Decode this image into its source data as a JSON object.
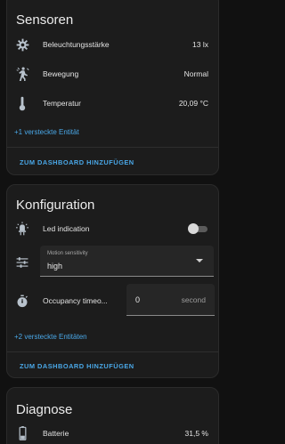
{
  "colors": {
    "background": "#111111",
    "card": "#1c1c1c",
    "icon": "#b8c2cc",
    "accent": "#4aa8e8",
    "battery": "#2e7d32"
  },
  "sensors": {
    "title": "Sensoren",
    "rows": [
      {
        "icon": "brightness-gear-icon",
        "label": "Beleuchtungsstärke",
        "value": "13 lx"
      },
      {
        "icon": "motion-sensor-icon",
        "label": "Bewegung",
        "value": "Normal"
      },
      {
        "icon": "thermometer-icon",
        "label": "Temperatur",
        "value": "20,09 °C"
      }
    ],
    "hidden_link": "+1 versteckte Entität",
    "action": "ZUM DASHBOARD HINZUFÜGEN"
  },
  "config": {
    "title": "Konfiguration",
    "led": {
      "icon": "led-icon",
      "label": "Led indication",
      "state": "off"
    },
    "motion": {
      "icon": "tune-sliders-icon",
      "field_label": "Motion sensitivity",
      "value": "high"
    },
    "occupancy": {
      "icon": "timer-icon",
      "label": "Occupancy timeo...",
      "value": "0",
      "unit": "second"
    },
    "hidden_link": "+2 versteckte Entitäten",
    "action": "ZUM DASHBOARD HINZUFÜGEN"
  },
  "diagnose": {
    "title": "Diagnose",
    "battery": {
      "icon": "battery-icon",
      "label": "Batterie",
      "value": "31,5 %",
      "level": 0.315
    }
  }
}
